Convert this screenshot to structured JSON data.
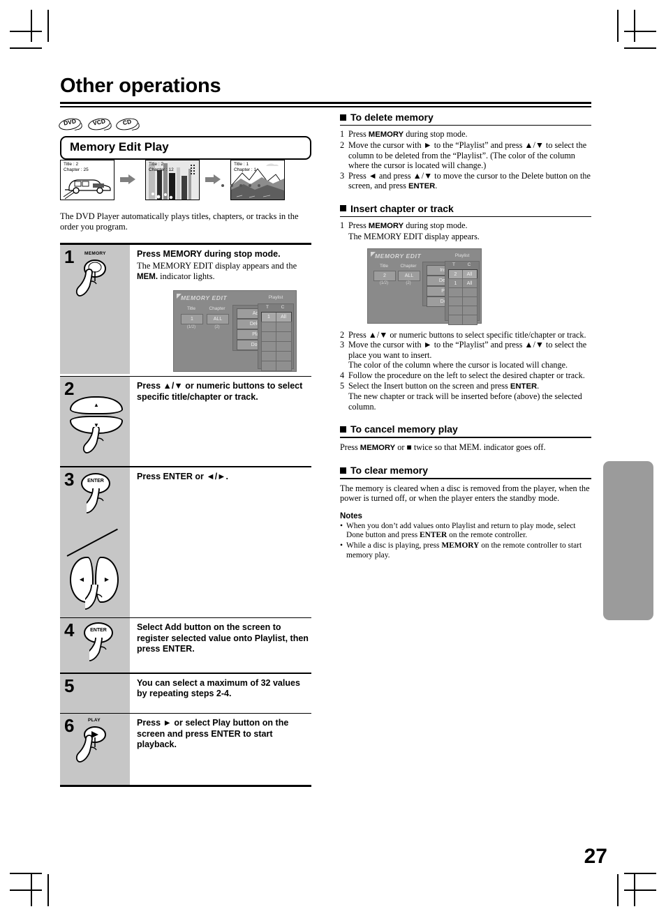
{
  "page": {
    "title": "Other operations",
    "number": "27"
  },
  "disc_badges": [
    {
      "label": "DVD"
    },
    {
      "label": "VCD"
    },
    {
      "label": "CD"
    }
  ],
  "section": {
    "heading": "Memory Edit Play",
    "intro": "The DVD Player automatically plays titles, chapters, or tracks in the order you program."
  },
  "thumbnails": [
    {
      "title": "Title : 2",
      "chapter": "Chapter : 25",
      "scene": "car"
    },
    {
      "title": "Title : 2",
      "chapter": "Chapter : 12",
      "scene": "city"
    },
    {
      "title": "Title : 1",
      "chapter": "Chapter : 1",
      "scene": "mountain"
    }
  ],
  "steps": [
    {
      "number": "1",
      "key": "MEMORY",
      "heading": "Press MEMORY during stop mode.",
      "sub_a": "The MEMORY EDIT display appears and the ",
      "sub_b": "MEM.",
      "sub_c": " indicator lights."
    },
    {
      "number": "2",
      "heading": "Press ▲/▼ or numeric buttons to select specific title/chapter or track."
    },
    {
      "number": "3",
      "key": "ENTER",
      "heading": "Press ENTER or ◄/►."
    },
    {
      "number": "4",
      "key": "ENTER",
      "heading": "Select Add button on the screen to register selected value onto Playlist, then press ENTER."
    },
    {
      "number": "5",
      "heading": "You can select a maximum of 32 values by repeating steps 2-4."
    },
    {
      "number": "6",
      "key": "PLAY",
      "heading": "Press ► or select Play button  on the screen and press ENTER to start playback."
    }
  ],
  "osd_step1": {
    "title": "MEMORY EDIT",
    "col_title_label": "Title",
    "col_title_value": "1",
    "col_title_sub": "(1/2)",
    "col_chapter_label": "Chapter",
    "col_chapter_value": "ALL",
    "col_chapter_sub": "(2)",
    "buttons": [
      "Add",
      "Delete",
      "Play",
      "Done"
    ],
    "playlist_label": "Playlist",
    "playlist_headers": [
      "T",
      "C"
    ],
    "playlist_rows": [
      {
        "t": "1",
        "c": "All",
        "selected": true
      },
      {
        "t": "",
        "c": "",
        "selected": false
      },
      {
        "t": "",
        "c": "",
        "selected": false
      },
      {
        "t": "",
        "c": "",
        "selected": false
      },
      {
        "t": "",
        "c": "",
        "selected": false
      },
      {
        "t": "",
        "c": "",
        "selected": false
      }
    ]
  },
  "osd_insert": {
    "title": "MEMORY EDIT",
    "col_title_label": "Title",
    "col_title_value": "2",
    "col_title_sub": "(1/2)",
    "col_chapter_label": "Chapter",
    "col_chapter_value": "ALL",
    "col_chapter_sub": "(2)",
    "buttons": [
      "Insert",
      "Delete",
      "Play",
      "Done"
    ],
    "playlist_label": "Playlist",
    "playlist_headers": [
      "T",
      "C"
    ],
    "playlist_rows": [
      {
        "t": "2",
        "c": "All",
        "selected": true
      },
      {
        "t": "1",
        "c": "All",
        "selected": false
      },
      {
        "t": "",
        "c": "",
        "selected": false
      },
      {
        "t": "",
        "c": "",
        "selected": false
      },
      {
        "t": "",
        "c": "",
        "selected": false
      },
      {
        "t": "",
        "c": "",
        "selected": false
      }
    ]
  },
  "right_column": {
    "delete_memory": {
      "heading": "To delete memory",
      "items": [
        {
          "n": "1",
          "html_a": "Press ",
          "bold": "MEMORY",
          "html_b": " during stop mode."
        },
        {
          "n": "2",
          "text": "Move the cursor with ► to the “Playlist” and press ▲/▼ to select the column to be deleted from the “Playlist”. (The color of the column where the cursor is located will change.)"
        },
        {
          "n": "3",
          "html_a": "Press ◄ and press ▲/▼ to move the cursor to the Delete button on the screen, and press ",
          "bold": "ENTER",
          "html_b": "."
        }
      ]
    },
    "insert_chapter": {
      "heading": "Insert chapter or track",
      "items": [
        {
          "n": "1",
          "html_a": "Press ",
          "bold": "MEMORY",
          "html_b": " during stop mode.\nThe MEMORY EDIT display appears."
        },
        {
          "n": "2",
          "text": "Press ▲/▼ or numeric buttons to select specific title/chapter or track."
        },
        {
          "n": "3",
          "text": "Move the cursor with ► to the “Playlist” and press ▲/▼ to select the place you want to insert.\nThe color of the column where the cursor is located will change."
        },
        {
          "n": "4",
          "text": "Follow the procedure on the left to select the desired chapter or track."
        },
        {
          "n": "5",
          "html_a": "Select the Insert button on the screen and press ",
          "bold": "ENTER",
          "html_b": ".\nThe new chapter or track will be inserted before (above) the selected column."
        }
      ]
    },
    "cancel_memory": {
      "heading": "To cancel memory play",
      "text_a": "Press ",
      "bold": "MEMORY",
      "text_b": " or ■  twice so that MEM. indicator goes off."
    },
    "clear_memory": {
      "heading": "To clear memory",
      "text": "The memory is cleared when a disc is removed from the player, when the power is turned off, or when the player enters the standby mode."
    },
    "notes": {
      "heading": "Notes",
      "items": [
        {
          "a": "When you don’t add values onto Playlist and return to play mode, select Done button and press ",
          "bold": "ENTER",
          "b": " on the remote controller."
        },
        {
          "a": "While a disc is playing, press ",
          "bold": "MEMORY",
          "b": " on the remote controller to start memory play."
        }
      ]
    }
  },
  "colors": {
    "step_panel": "#c6c6c6",
    "osd_bg": "#8a8a8a",
    "tab": "#9b9b9b"
  }
}
